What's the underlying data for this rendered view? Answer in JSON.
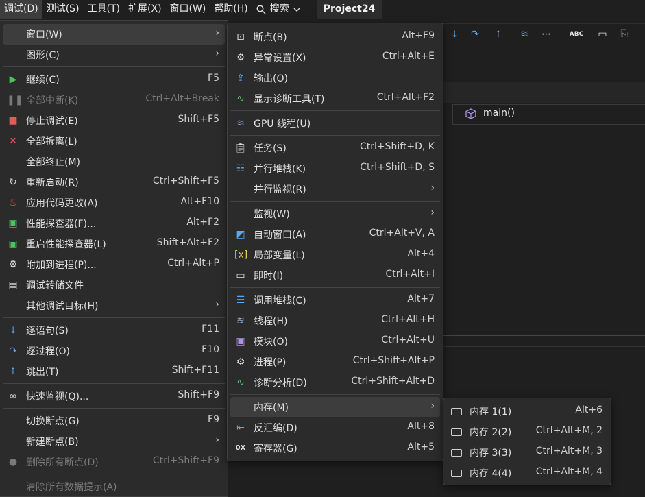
{
  "menubar": {
    "items": [
      "调试(D)",
      "测试(S)",
      "工具(T)",
      "扩展(X)",
      "窗口(W)",
      "帮助(H)"
    ],
    "search_label": "搜索",
    "project": "Project24"
  },
  "editor": {
    "nav_function": "main()"
  },
  "debug_menu": {
    "items": [
      {
        "label": "窗口(W)"
      },
      {
        "label": "图形(C)"
      },
      {
        "label": "继续(C)",
        "shortcut": "F5"
      },
      {
        "label": "全部中断(K)",
        "shortcut": "Ctrl+Alt+Break"
      },
      {
        "label": "停止调试(E)",
        "shortcut": "Shift+F5"
      },
      {
        "label": "全部拆离(L)"
      },
      {
        "label": "全部终止(M)"
      },
      {
        "label": "重新启动(R)",
        "shortcut": "Ctrl+Shift+F5"
      },
      {
        "label": "应用代码更改(A)",
        "shortcut": "Alt+F10"
      },
      {
        "label": "性能探查器(F)...",
        "shortcut": "Alt+F2"
      },
      {
        "label": "重启性能探查器(L)",
        "shortcut": "Shift+Alt+F2"
      },
      {
        "label": "附加到进程(P)...",
        "shortcut": "Ctrl+Alt+P"
      },
      {
        "label": "调试转储文件"
      },
      {
        "label": "其他调试目标(H)"
      },
      {
        "label": "逐语句(S)",
        "shortcut": "F11"
      },
      {
        "label": "逐过程(O)",
        "shortcut": "F10"
      },
      {
        "label": "跳出(T)",
        "shortcut": "Shift+F11"
      },
      {
        "label": "快速监视(Q)...",
        "shortcut": "Shift+F9"
      },
      {
        "label": "切换断点(G)",
        "shortcut": "F9"
      },
      {
        "label": "新建断点(B)"
      },
      {
        "label": "删除所有断点(D)",
        "shortcut": "Ctrl+Shift+F9"
      },
      {
        "label": "清除所有数据提示(A)"
      }
    ]
  },
  "window_menu": {
    "items": [
      {
        "label": "断点(B)",
        "shortcut": "Alt+F9"
      },
      {
        "label": "异常设置(X)",
        "shortcut": "Ctrl+Alt+E"
      },
      {
        "label": "输出(O)"
      },
      {
        "label": "显示诊断工具(T)",
        "shortcut": "Ctrl+Alt+F2"
      },
      {
        "label": "GPU 线程(U)"
      },
      {
        "label": "任务(S)",
        "shortcut": "Ctrl+Shift+D, K"
      },
      {
        "label": "并行堆栈(K)",
        "shortcut": "Ctrl+Shift+D, S"
      },
      {
        "label": "并行监视(R)"
      },
      {
        "label": "监视(W)"
      },
      {
        "label": "自动窗口(A)",
        "shortcut": "Ctrl+Alt+V, A"
      },
      {
        "label": "局部变量(L)",
        "shortcut": "Alt+4"
      },
      {
        "label": "即时(I)",
        "shortcut": "Ctrl+Alt+I"
      },
      {
        "label": "调用堆栈(C)",
        "shortcut": "Alt+7"
      },
      {
        "label": "线程(H)",
        "shortcut": "Ctrl+Alt+H"
      },
      {
        "label": "模块(O)",
        "shortcut": "Ctrl+Alt+U"
      },
      {
        "label": "进程(P)",
        "shortcut": "Ctrl+Shift+Alt+P"
      },
      {
        "label": "诊断分析(D)",
        "shortcut": "Ctrl+Shift+Alt+D"
      },
      {
        "label": "内存(M)"
      },
      {
        "label": "反汇编(D)",
        "shortcut": "Alt+8"
      },
      {
        "label": "寄存器(G)",
        "shortcut": "Alt+5"
      }
    ]
  },
  "memory_menu": {
    "items": [
      {
        "label": "内存 1(1)",
        "shortcut": "Alt+6"
      },
      {
        "label": "内存 2(2)",
        "shortcut": "Ctrl+Alt+M, 2"
      },
      {
        "label": "内存 3(3)",
        "shortcut": "Ctrl+Alt+M, 3"
      },
      {
        "label": "内存 4(4)",
        "shortcut": "Ctrl+Alt+M, 4"
      }
    ]
  }
}
